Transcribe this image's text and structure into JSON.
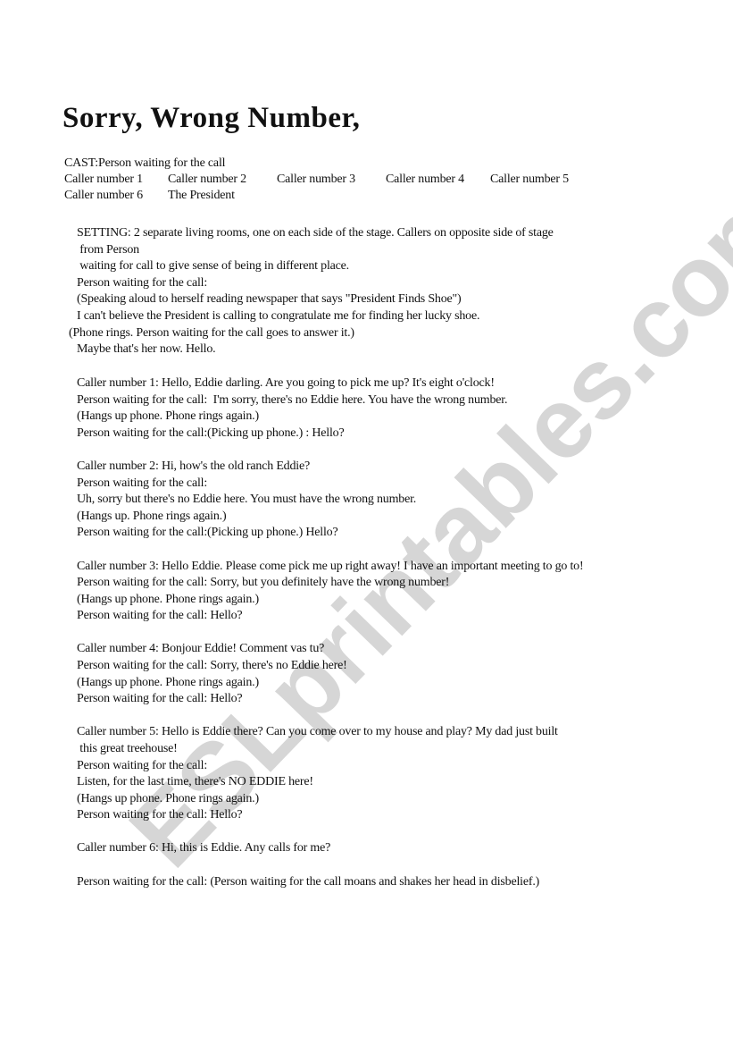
{
  "document": {
    "title": "Sorry, Wrong Number,",
    "watermark": "ESLprintables.com",
    "cast": {
      "line1": "CAST:Person waiting for the call",
      "members_row1": [
        "Caller number 1",
        "Caller number 2",
        "Caller number 3",
        "Caller number 4",
        "Caller number 5"
      ],
      "members_row2": [
        "Caller number 6",
        "The President"
      ]
    },
    "setting": [
      "SETTING: 2 separate living rooms, one on each side of the stage. Callers on opposite side of stage",
      " from Person",
      " waiting for call to give sense of being in different place."
    ],
    "opening": [
      "Person waiting for the call:",
      "(Speaking aloud to herself reading newspaper that says \"President Finds Shoe\")",
      "I can't believe the President is calling to congratulate me for finding her lucky shoe.",
      "(Phone rings. Person waiting for the call goes to answer it.)",
      "Maybe that's her now. Hello."
    ],
    "scenes": [
      {
        "lines": [
          "Caller number 1: Hello, Eddie darling. Are you going to pick me up? It's eight o'clock!",
          "Person waiting for the call:  I'm sorry, there's no Eddie here. You have the wrong number.",
          "(Hangs up phone. Phone rings again.)",
          "Person waiting for the call:(Picking up phone.) : Hello?"
        ]
      },
      {
        "lines": [
          "Caller number 2: Hi, how's the old ranch Eddie?",
          "Person waiting for the call:",
          "Uh, sorry but there's no Eddie here. You must have the wrong number.",
          "(Hangs up. Phone rings again.)",
          "Person waiting for the call:(Picking up phone.) Hello?"
        ]
      },
      {
        "lines": [
          "Caller number 3: Hello Eddie. Please come pick me up right away! I have an important meeting to go to!",
          "Person waiting for the call: Sorry, but you definitely have the wrong number!",
          "(Hangs up phone. Phone rings again.)",
          "Person waiting for the call: Hello?"
        ]
      },
      {
        "lines": [
          "Caller number 4: Bonjour Eddie! Comment vas tu?",
          "Person waiting for the call: Sorry, there's no Eddie here!",
          "(Hangs up phone. Phone rings again.)",
          "Person waiting for the call: Hello?"
        ]
      },
      {
        "lines": [
          "Caller number 5: Hello is Eddie there? Can you come over to my house and play? My dad just built",
          " this great treehouse!",
          "Person waiting for the call:",
          "Listen, for the last time, there's NO EDDIE here!",
          "(Hangs up phone. Phone rings again.)",
          "Person waiting for the call: Hello?"
        ]
      },
      {
        "lines": [
          "Caller number 6: Hi, this is Eddie. Any calls for me?"
        ]
      },
      {
        "lines": [
          "Person waiting for the call: (Person waiting for the call moans and shakes her head in disbelief.)"
        ]
      }
    ]
  }
}
